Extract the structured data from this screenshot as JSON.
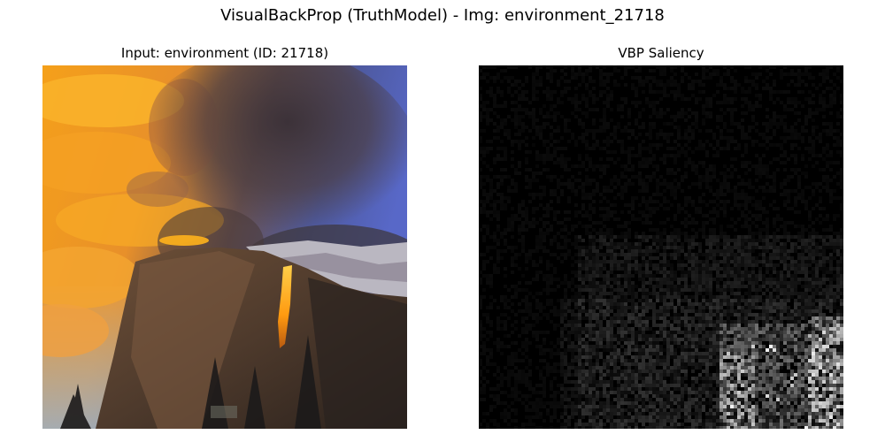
{
  "figure": {
    "suptitle": "VisualBackProp (TruthModel) - Img: environment_21718"
  },
  "panels": [
    {
      "title": "Input: environment (ID: 21718)",
      "content": "photo of a cliff face under an orange sunset sky with dark storm clouds and a glowing waterfall"
    },
    {
      "title": "VBP Saliency",
      "content": "grayscale saliency map, mostly black with bright speckles toward the lower right"
    }
  ],
  "colors": {
    "background": "#ffffff",
    "sky_orange": "#f7a21b",
    "sky_blue": "#5868c8",
    "cloud_dark": "#3e3436",
    "cliff_brown": "#5a4030",
    "waterfall_glow": "#ffb11e",
    "saliency_background": "#000000",
    "saliency_speckle": "#ffffff"
  }
}
